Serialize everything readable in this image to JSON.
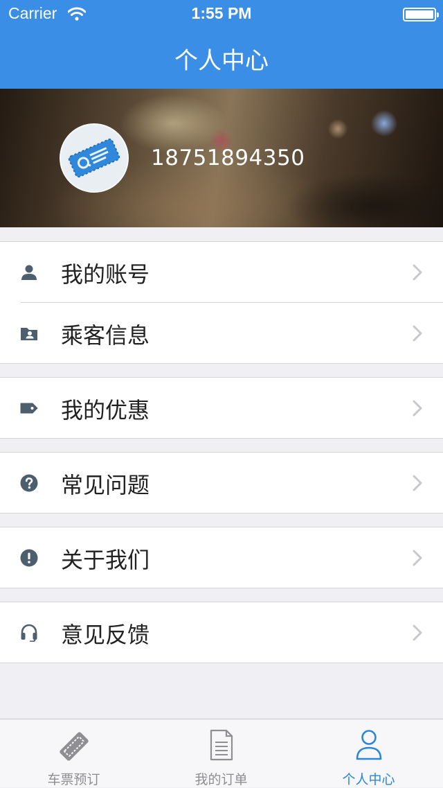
{
  "status_bar": {
    "carrier": "Carrier",
    "time": "1:55 PM"
  },
  "nav": {
    "title": "个人中心"
  },
  "profile": {
    "phone": "18751894350"
  },
  "menu": {
    "account": "我的账号",
    "passengers": "乘客信息",
    "coupons": "我的优惠",
    "faq": "常见问题",
    "about": "关于我们",
    "feedback": "意见反馈"
  },
  "tabs": [
    {
      "label": "车票预订",
      "icon": "ticket-icon",
      "active": false
    },
    {
      "label": "我的订单",
      "icon": "document-icon",
      "active": false
    },
    {
      "label": "个人中心",
      "icon": "person-icon",
      "active": true
    }
  ],
  "colors": {
    "accent": "#3a8ee6",
    "tab_active": "#2a86d8",
    "icon_gray": "#4d5f6e",
    "background": "#efeff4"
  }
}
